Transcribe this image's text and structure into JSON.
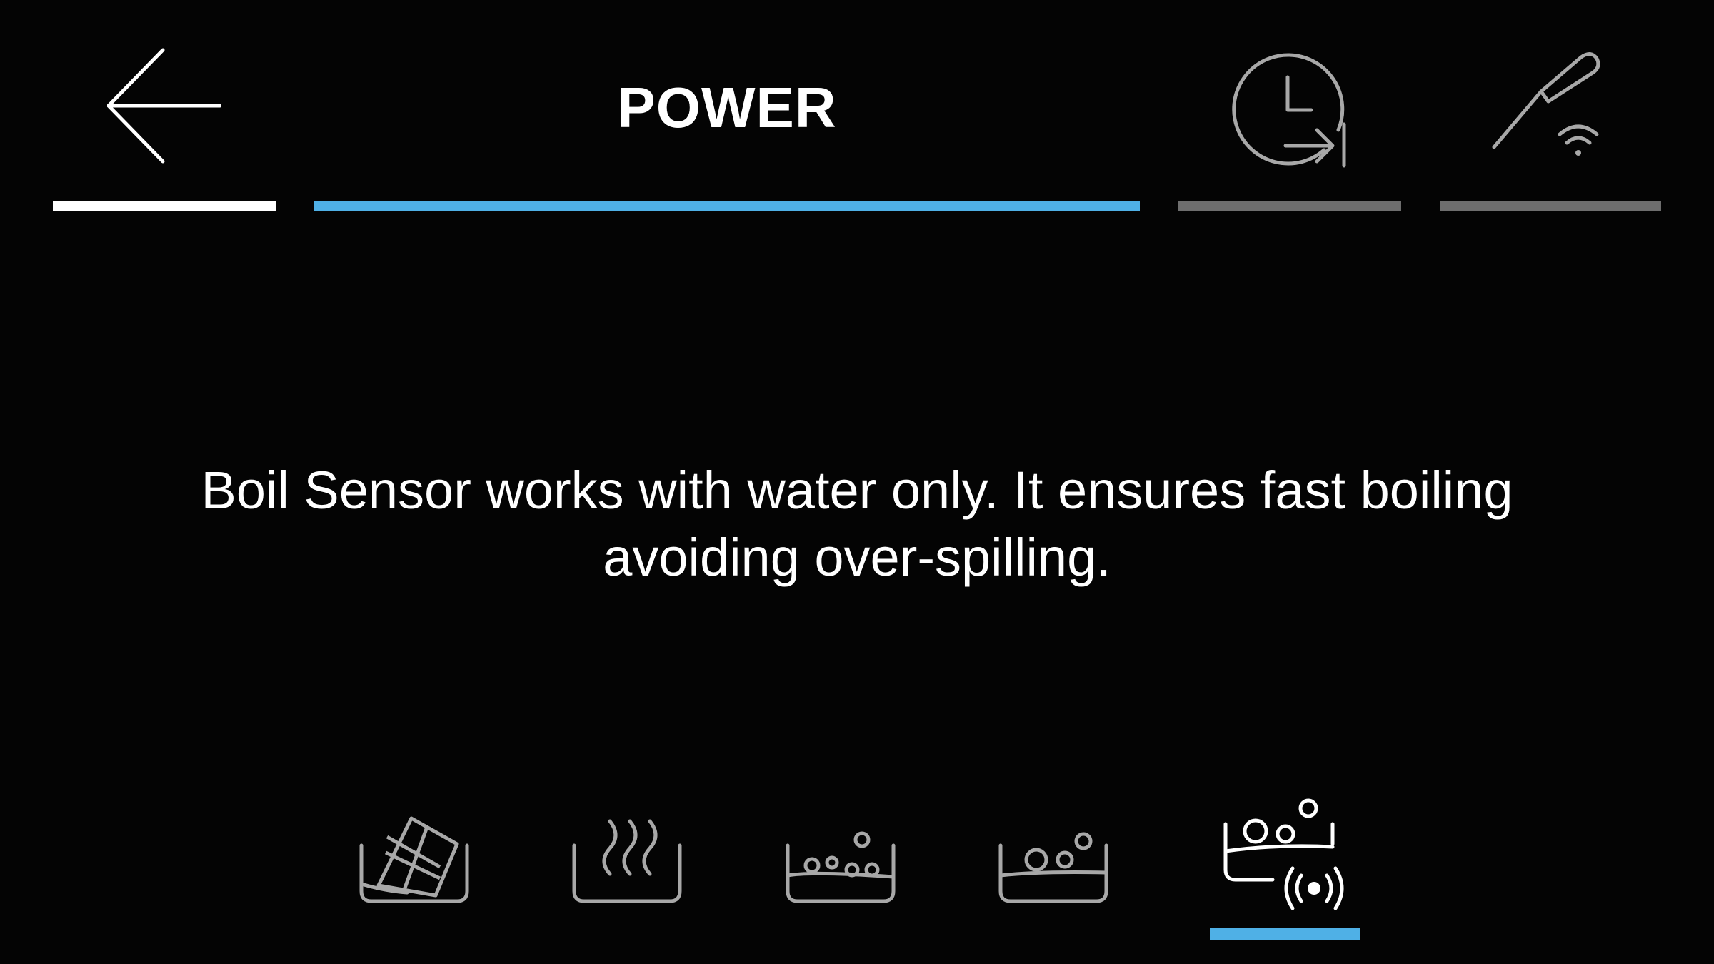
{
  "header": {
    "back_icon": "arrow-left-icon",
    "title": "POWER",
    "timer_icon": "clock-timer-icon",
    "probe_icon": "wireless-probe-icon"
  },
  "tabs": [
    {
      "id": "back",
      "state": "white",
      "color": "#ffffff"
    },
    {
      "id": "power",
      "state": "active",
      "color": "#4fb0e6"
    },
    {
      "id": "timer",
      "state": "inactive",
      "color": "#6e6e6e"
    },
    {
      "id": "probe",
      "state": "inactive",
      "color": "#6e6e6e"
    }
  ],
  "message": {
    "line1": "Boil Sensor works with water only. It ensures fast boiling",
    "line2": "avoiding over-spilling."
  },
  "modes": [
    {
      "icon": "melt-chocolate-icon",
      "selected": false
    },
    {
      "icon": "simmer-steam-icon",
      "selected": false
    },
    {
      "icon": "boil-low-bubbles-icon",
      "selected": false
    },
    {
      "icon": "boil-bubbles-icon",
      "selected": false
    },
    {
      "icon": "boil-sensor-icon",
      "selected": true
    }
  ],
  "colors": {
    "background": "#040404",
    "accent": "#4fb0e6",
    "inactive": "#6e6e6e",
    "icon_stroke": "#a8a8a8",
    "text": "#ffffff"
  }
}
